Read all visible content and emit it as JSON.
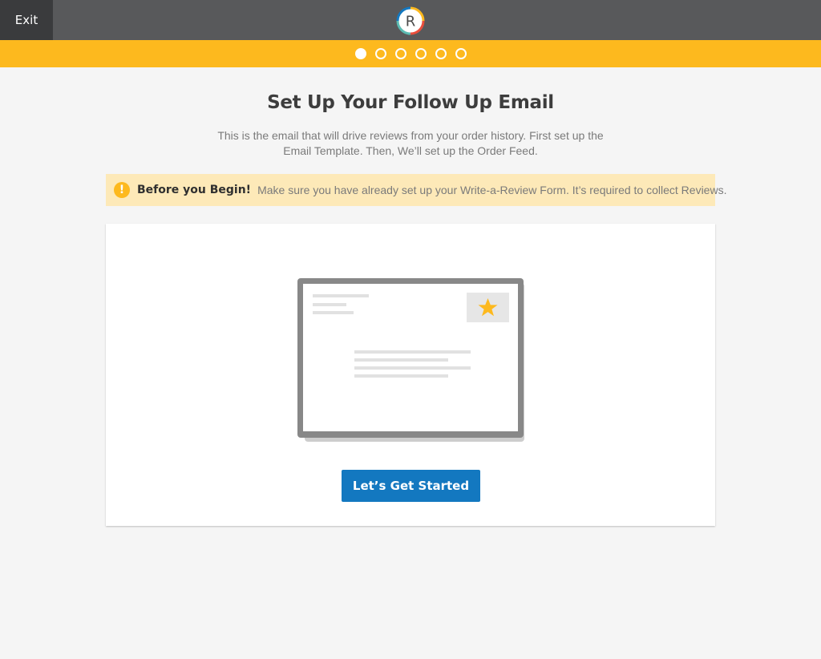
{
  "header": {
    "exit_label": "Exit",
    "logo_letter": "R",
    "logo_colors": [
      "#fdb91e",
      "#e94e3c",
      "#1378c0",
      "#5cbcb3"
    ]
  },
  "progress": {
    "total_steps": 6,
    "current_step": 1
  },
  "main": {
    "title": "Set Up Your Follow Up Email",
    "subtitle": "This is the email that will drive reviews from your order history. First set up the Email Template. Then, We’ll set up the Order Feed."
  },
  "alert": {
    "icon": "exclamation-icon",
    "title": "Before you Begin!",
    "text": "Make sure you have already set up your Write-a-Review Form. It’s required to collect Reviews."
  },
  "card": {
    "illustration_icon": "email-envelope-star-icon",
    "cta_label": "Let’s Get Started"
  },
  "colors": {
    "accent_yellow": "#fdb91e",
    "topbar": "#58595b",
    "exit_bg": "#3a3b3d",
    "primary_blue": "#1378c0",
    "alert_bg": "#fde9b8"
  }
}
